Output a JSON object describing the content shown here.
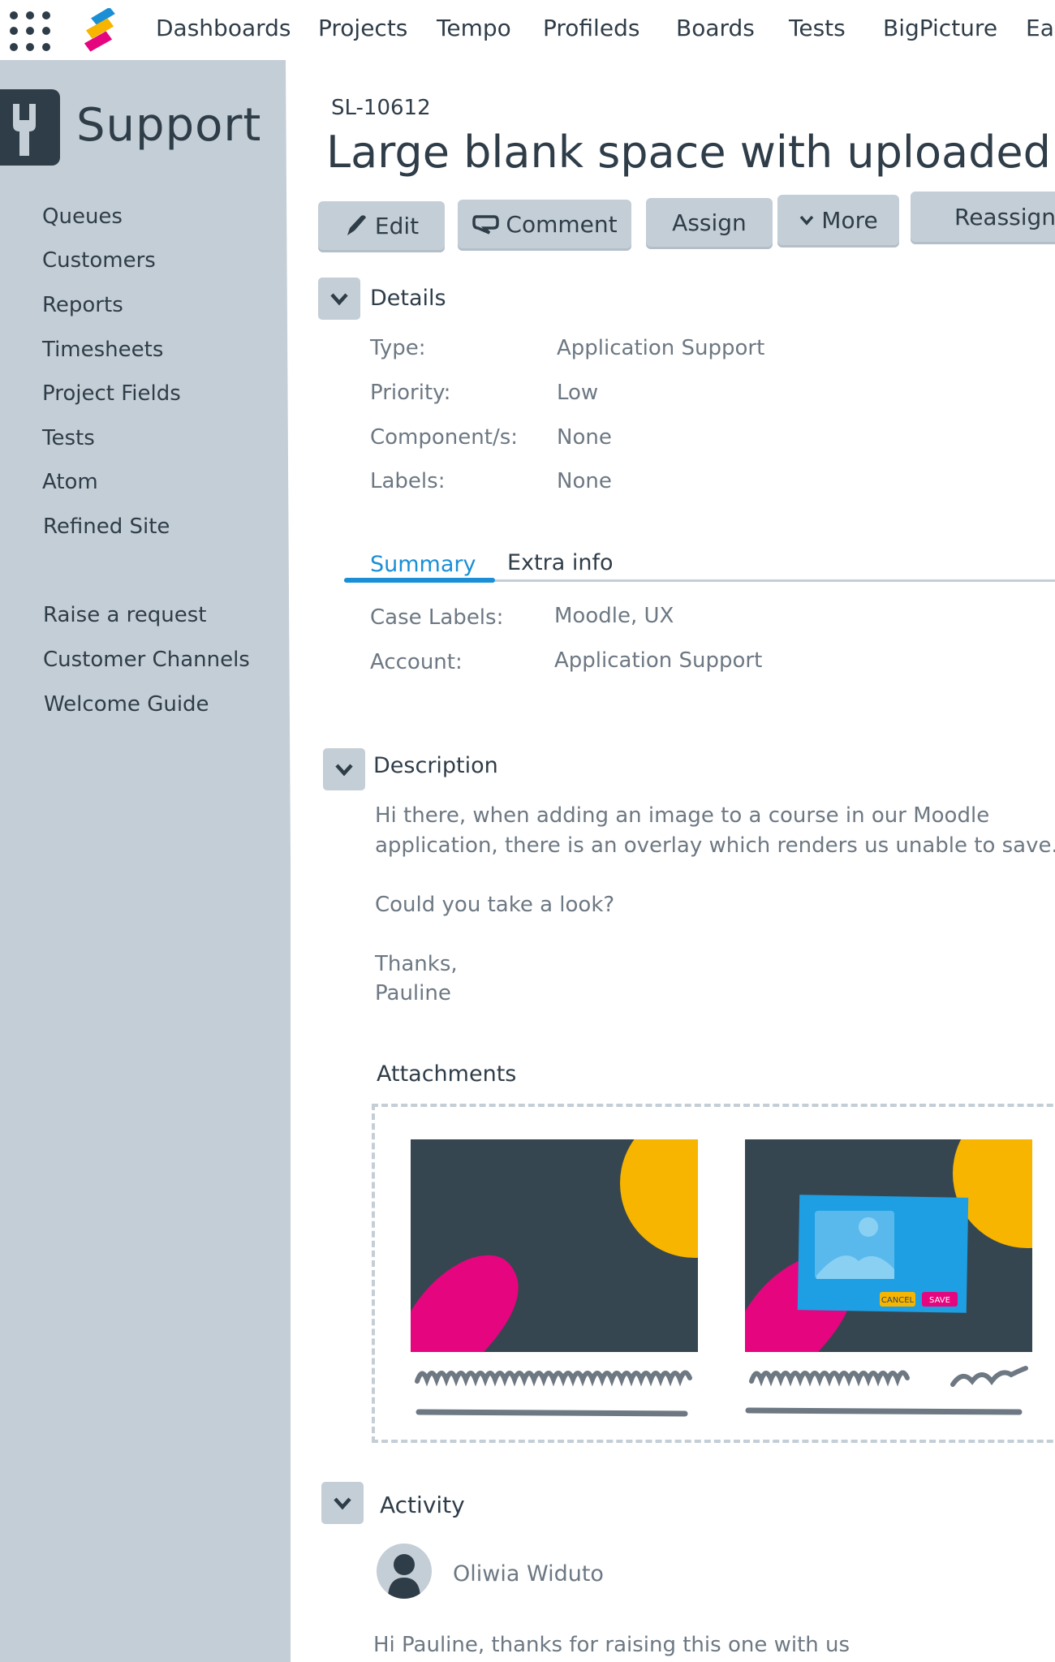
{
  "nav": {
    "items": [
      "Dashboards",
      "Projects",
      "Tempo",
      "Profileds",
      "Boards",
      "Tests",
      "BigPicture",
      "Eas"
    ]
  },
  "sidebar": {
    "title": "Support",
    "items": [
      "Queues",
      "Customers",
      "Reports",
      "Timesheets",
      "Project Fields",
      "Tests",
      "Atom",
      "Refined Site"
    ],
    "items2": [
      "Raise a request",
      "Customer Channels",
      "Welcome Guide"
    ]
  },
  "issue": {
    "key": "SL-10612",
    "title": "Large blank space with uploaded c"
  },
  "toolbar": {
    "edit": "Edit",
    "comment": "Comment",
    "assign": "Assign",
    "more": "More",
    "reassign": "Reassign"
  },
  "details": {
    "heading": "Details",
    "rows": [
      {
        "label": "Type:",
        "value": "Application Support"
      },
      {
        "label": "Priority:",
        "value": "Low"
      },
      {
        "label": "Component/s:",
        "value": "None"
      },
      {
        "label": "Labels:",
        "value": "None"
      }
    ]
  },
  "tabs": {
    "summary": "Summary",
    "extra": "Extra info",
    "rows": [
      {
        "label": "Case Labels:",
        "value": "Moodle, UX"
      },
      {
        "label": "Account:",
        "value": "Application Support"
      }
    ]
  },
  "description": {
    "heading": "Description",
    "lines": [
      "Hi there, when adding an image to a course in our Moodle",
      "application, there is an overlay which renders us unable to save.",
      "Could you take a look?",
      "Thanks,",
      "Pauline"
    ]
  },
  "attachments": {
    "heading": "Attachments",
    "dialog_cancel": "CANCEL",
    "dialog_save": "SAVE"
  },
  "activity": {
    "heading": "Activity",
    "commenter": "Oliwia Widuto",
    "comment": "Hi Pauline, thanks for raising this one with us"
  },
  "colors": {
    "sidebar": "#c4ced6",
    "text": "#2f3d49",
    "muted": "#6d7883",
    "accent": "#1a8fd6",
    "thumb_bg": "#364650",
    "yellow": "#f7b500",
    "magenta": "#e5057f"
  }
}
